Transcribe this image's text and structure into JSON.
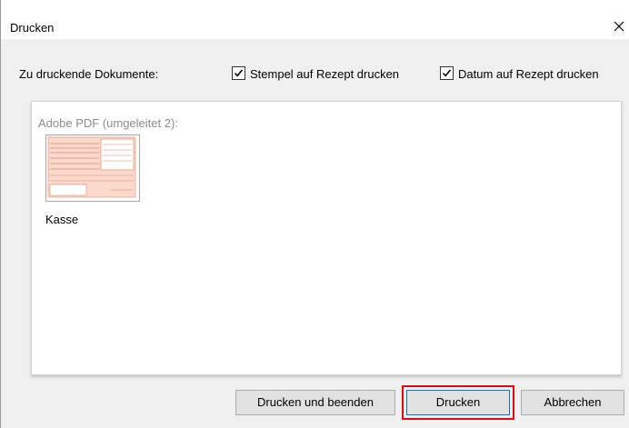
{
  "window": {
    "title": "Drucken",
    "close_icon": "close-icon"
  },
  "options": {
    "documents_label": "Zu druckende Dokumente:",
    "stempel": {
      "label": "Stempel auf Rezept drucken",
      "checked": true
    },
    "datum": {
      "label": "Datum auf Rezept drucken",
      "checked": true
    }
  },
  "printer": {
    "label": "Adobe PDF (umgeleitet 2):",
    "documents": [
      {
        "name": "Kasse"
      }
    ]
  },
  "buttons": {
    "print_and_exit": "Drucken und beenden",
    "print": "Drucken",
    "cancel": "Abbrechen"
  },
  "colors": {
    "highlight": "#e30613",
    "form_tint": "#f7b8a0",
    "default_button_border": "#0078d7"
  }
}
